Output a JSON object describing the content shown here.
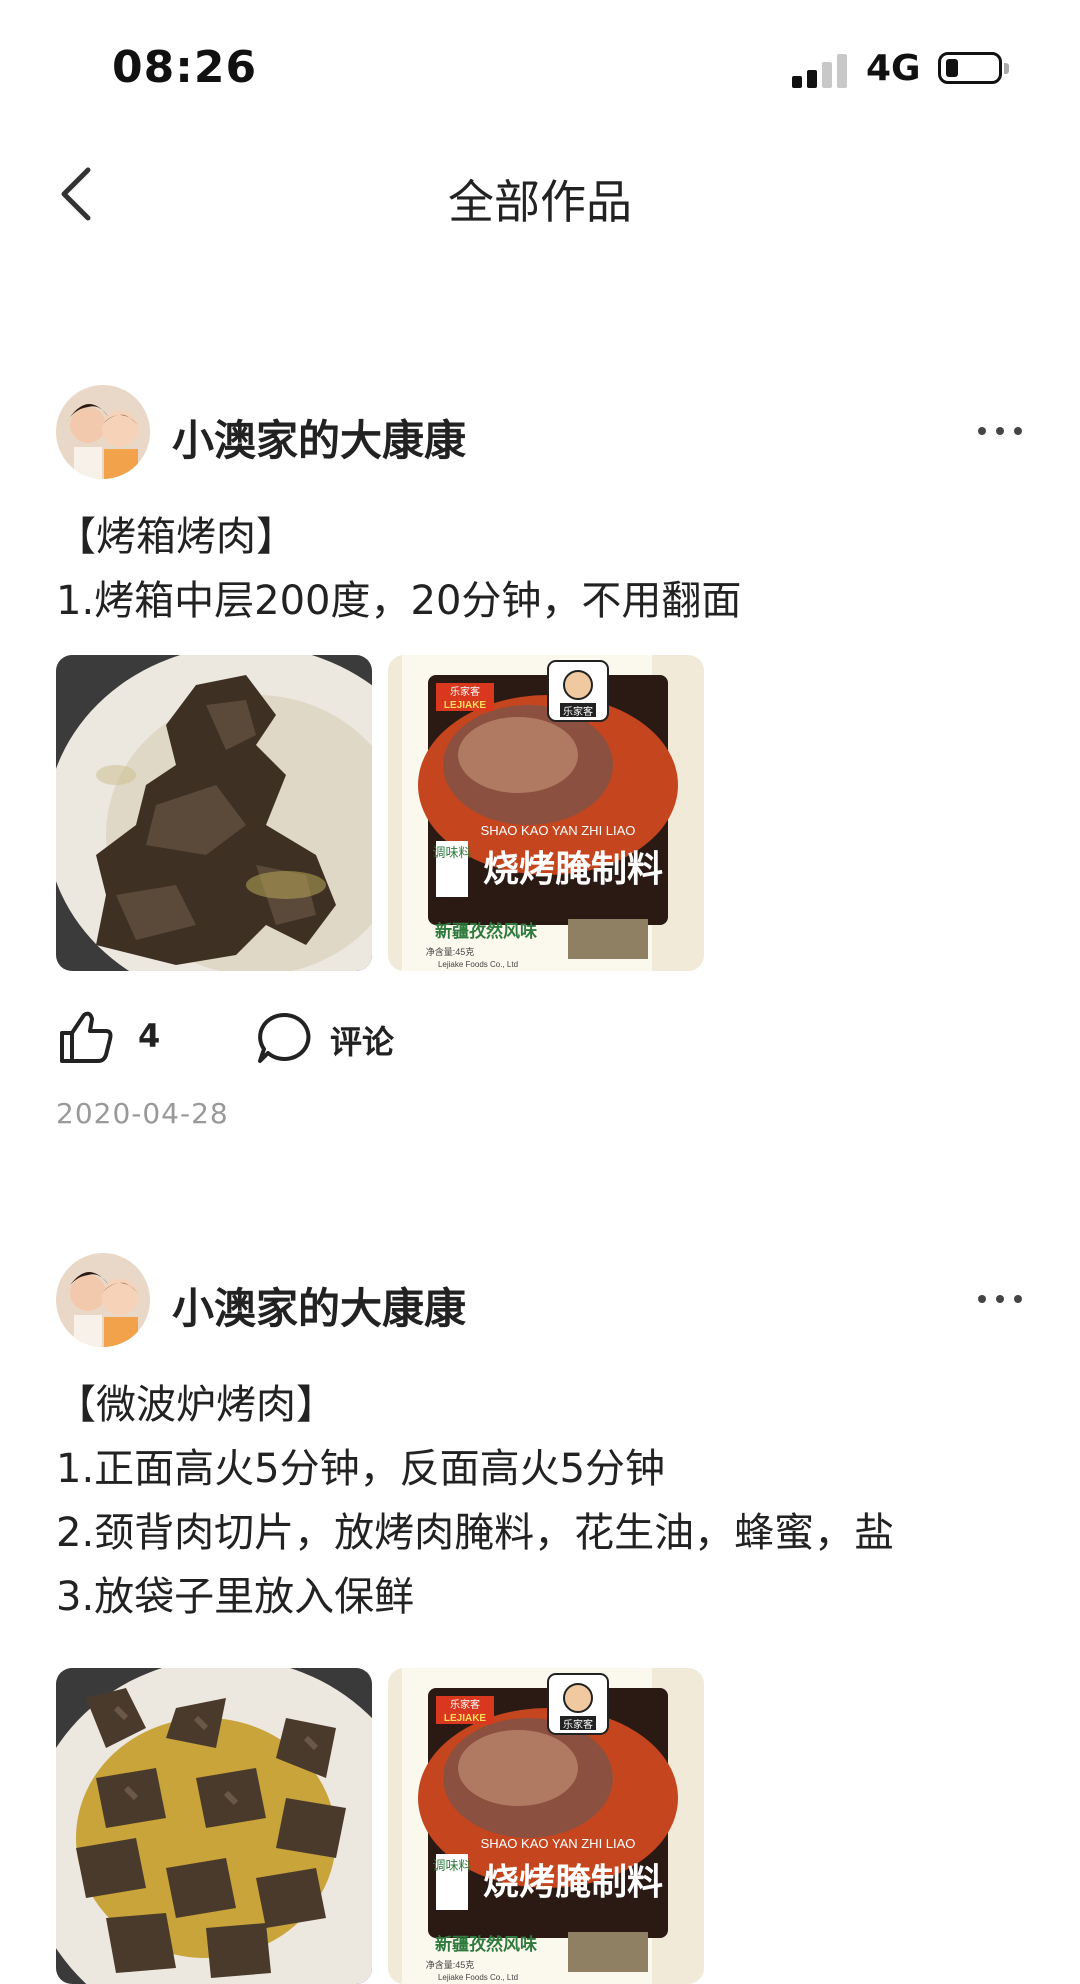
{
  "status_bar": {
    "time": "08:26",
    "network": "4G",
    "signal_icon": "cell-signal-icon",
    "battery_icon": "battery-icon",
    "battery_level": 0.2
  },
  "nav": {
    "title": "全部作品",
    "back_icon": "chevron-left-icon"
  },
  "posts": [
    {
      "username": "小澳家的大康康",
      "lines": [
        "【烤箱烤肉】",
        "1.烤箱中层200度，20分钟，不用翻面"
      ],
      "photos": [
        {
          "icon": "grilled-meat-photo"
        },
        {
          "icon": "seasoning-package-photo",
          "package_brand": "乐家客",
          "package_latin": "LEJIAKE",
          "package_name": "烧烤腌制料",
          "package_pinyin": "SHAO KAO YAN ZHI LIAO",
          "package_tag": "调味料",
          "package_flavor": "新疆孜然风味",
          "package_net": "净含量:45克",
          "package_company": "Lejiake Foods Co., Ltd"
        }
      ],
      "likes": "4",
      "comment_label": "评论",
      "date": "2020-04-28"
    },
    {
      "username": "小澳家的大康康",
      "lines": [
        "【微波炉烤肉】",
        "1.正面高火5分钟，反面高火5分钟",
        "2.颈背肉切片，放烤肉腌料，花生油，蜂蜜，盐",
        "3.放袋子里放入保鲜"
      ],
      "photos": [
        {
          "icon": "grilled-meat-photo"
        },
        {
          "icon": "seasoning-package-photo",
          "package_brand": "乐家客",
          "package_latin": "LEJIAKE",
          "package_name": "烧烤腌制料",
          "package_pinyin": "SHAO KAO YAN ZHI LIAO",
          "package_tag": "调味料",
          "package_flavor": "新疆孜然风味",
          "package_net": "净含量:45克",
          "package_company": "Lejiake Foods Co., Ltd"
        }
      ]
    }
  ]
}
